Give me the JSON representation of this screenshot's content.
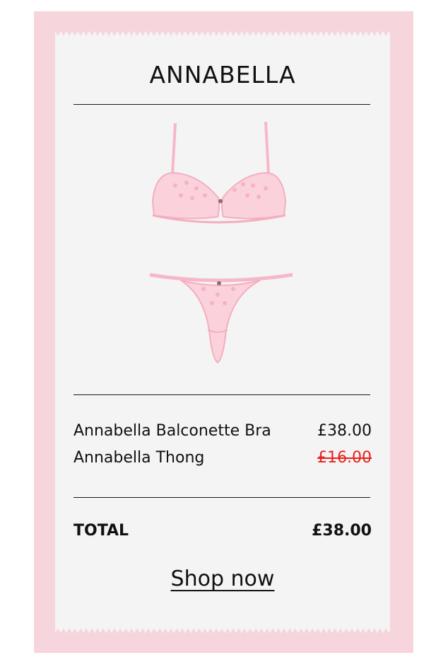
{
  "brand": {
    "title": "ANNABELLA"
  },
  "product_image": {
    "icon": "lingerie-set-icon",
    "items": [
      "bra",
      "thong"
    ],
    "color": "#f9c6d3"
  },
  "line_items": [
    {
      "name": "Annabella Balconette Bra",
      "price": "£38.00",
      "struck": false
    },
    {
      "name": "Annabella Thong",
      "price": "£16.00",
      "struck": true
    }
  ],
  "total": {
    "label": "TOTAL",
    "amount": "£38.00"
  },
  "cta": {
    "label": "Shop now"
  },
  "colors": {
    "frame": "#f7d5dc",
    "receipt": "#f4f4f4",
    "strike_price": "#e8221f",
    "text": "#111111"
  }
}
